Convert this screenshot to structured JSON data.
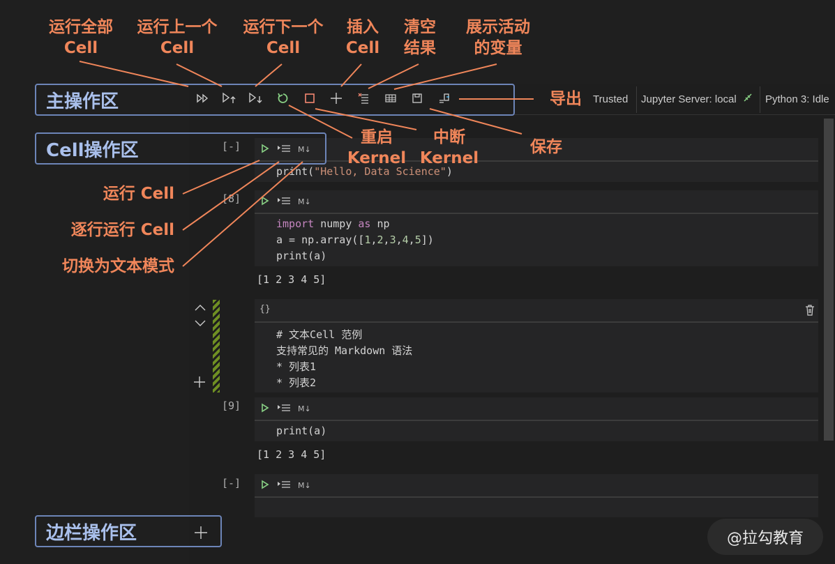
{
  "toolbar": {
    "buttons": [
      {
        "name": "run-all-icon",
        "glyph": "▷▷"
      },
      {
        "name": "run-above-icon",
        "glyph": "▷↑"
      },
      {
        "name": "run-below-icon",
        "glyph": "▷↓"
      },
      {
        "name": "restart-kernel-icon",
        "glyph": "↻"
      },
      {
        "name": "interrupt-kernel-icon",
        "glyph": "□"
      },
      {
        "name": "insert-cell-icon",
        "glyph": "+"
      },
      {
        "name": "clear-outputs-icon",
        "glyph": "≡"
      },
      {
        "name": "variables-icon",
        "glyph": "▦"
      },
      {
        "name": "save-icon",
        "glyph": "🖫"
      },
      {
        "name": "export-icon",
        "glyph": "⇲"
      }
    ],
    "trusted": "Trusted",
    "server": "Jupyter Server: local",
    "kernel": "Python 3: Idle"
  },
  "cells": [
    {
      "exec": "[-]",
      "type": "code",
      "code": "print(\"Hello, Data Science\")"
    },
    {
      "exec": "[8]",
      "type": "code",
      "code_lines": [
        "import numpy as np",
        "a = np.array([1,2,3,4,5])",
        "print(a)"
      ],
      "output": "[1 2 3 4 5]"
    },
    {
      "type": "markdown",
      "label": "{}",
      "lines": [
        "# 文本Cell 范例",
        "支持常见的 Markdown 语法",
        "* 列表1",
        "* 列表2"
      ]
    },
    {
      "exec": "[9]",
      "type": "code",
      "code": "print(a)",
      "output": "[1 2 3 4 5]"
    },
    {
      "exec": "[-]",
      "type": "code",
      "code": ""
    }
  ],
  "cell_md_label": "M↓",
  "annotations": {
    "run_all": "运行全部\nCell",
    "run_above": "运行上一个\nCell",
    "run_below": "运行下一个\nCell",
    "insert": "插入\nCell",
    "clear": "清空\n结果",
    "variables": "展示活动\n的变量",
    "export": "导出",
    "restart": "重启\nKernel",
    "interrupt": "中断\nKernel",
    "save": "保存",
    "run_cell": "运行 Cell",
    "run_by_line": "逐行运行 Cell",
    "toggle_md": "切换为文本模式"
  },
  "boxes": {
    "main": "主操作区",
    "cell": "Cell操作区",
    "sidebar": "边栏操作区"
  },
  "watermark": "@拉勾教育",
  "colors": {
    "accent": "#f0865a",
    "box": "#6d85b8",
    "run": "#89d185",
    "restart": "#89d185",
    "interrupt": "#f48771"
  }
}
